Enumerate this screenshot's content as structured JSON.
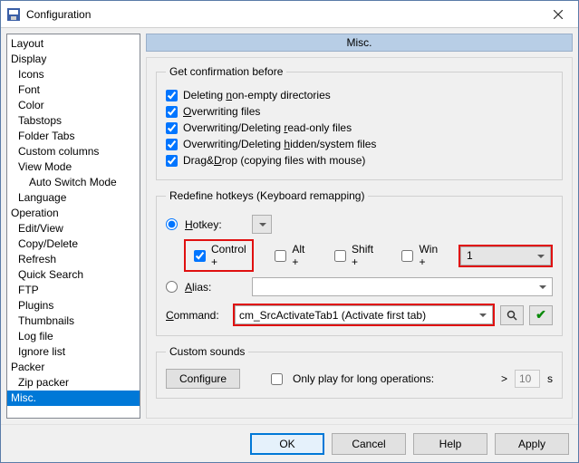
{
  "window": {
    "title": "Configuration"
  },
  "tree": {
    "items": [
      {
        "label": "Layout",
        "depth": 0
      },
      {
        "label": "Display",
        "depth": 0
      },
      {
        "label": "Icons",
        "depth": 1
      },
      {
        "label": "Font",
        "depth": 1
      },
      {
        "label": "Color",
        "depth": 1
      },
      {
        "label": "Tabstops",
        "depth": 1
      },
      {
        "label": "Folder Tabs",
        "depth": 1
      },
      {
        "label": "Custom columns",
        "depth": 1
      },
      {
        "label": "View Mode",
        "depth": 1
      },
      {
        "label": "Auto Switch Mode",
        "depth": 2
      },
      {
        "label": "Language",
        "depth": 1
      },
      {
        "label": "Operation",
        "depth": 0
      },
      {
        "label": "Edit/View",
        "depth": 1
      },
      {
        "label": "Copy/Delete",
        "depth": 1
      },
      {
        "label": "Refresh",
        "depth": 1
      },
      {
        "label": "Quick Search",
        "depth": 1
      },
      {
        "label": "FTP",
        "depth": 1
      },
      {
        "label": "Plugins",
        "depth": 1
      },
      {
        "label": "Thumbnails",
        "depth": 1
      },
      {
        "label": "Log file",
        "depth": 1
      },
      {
        "label": "Ignore list",
        "depth": 1
      },
      {
        "label": "Packer",
        "depth": 0
      },
      {
        "label": "Zip packer",
        "depth": 1
      },
      {
        "label": "Misc.",
        "depth": 0,
        "selected": true
      }
    ]
  },
  "page": {
    "header": "Misc."
  },
  "confirm": {
    "legend": "Get confirmation before",
    "items": [
      {
        "pre": "Deleting ",
        "u": "n",
        "post": "on-empty directories",
        "checked": true
      },
      {
        "pre": "",
        "u": "O",
        "post": "verwriting files",
        "checked": true
      },
      {
        "pre": "Overwriting/Deleting ",
        "u": "r",
        "post": "ead-only files",
        "checked": true
      },
      {
        "pre": "Overwriting/Deleting ",
        "u": "h",
        "post": "idden/system files",
        "checked": true
      },
      {
        "pre": "Drag&",
        "u": "D",
        "post": "rop (copying files with mouse)",
        "checked": true
      }
    ]
  },
  "hotkeys": {
    "legend": "Redefine hotkeys (Keyboard remapping)",
    "hotkey_label": "Hotkey:",
    "alias_label": "Alias:",
    "mods": {
      "ctrl": {
        "label": "Control +",
        "checked": true
      },
      "alt": {
        "label": "Alt +",
        "checked": false
      },
      "shift": {
        "label": "Shift +",
        "checked": false
      },
      "win": {
        "label": "Win +",
        "checked": false
      }
    },
    "key": "1",
    "command_label": "Command:",
    "command_value": "cm_SrcActivateTab1 (Activate first tab)"
  },
  "sounds": {
    "legend": "Custom sounds",
    "configure": "Configure",
    "only_long_label": "Only play for long operations:",
    "only_long_checked": false,
    "gt": ">",
    "seconds_value": "10",
    "seconds_unit": "s"
  },
  "footer": {
    "ok": "OK",
    "cancel": "Cancel",
    "help": "Help",
    "apply": "Apply"
  }
}
